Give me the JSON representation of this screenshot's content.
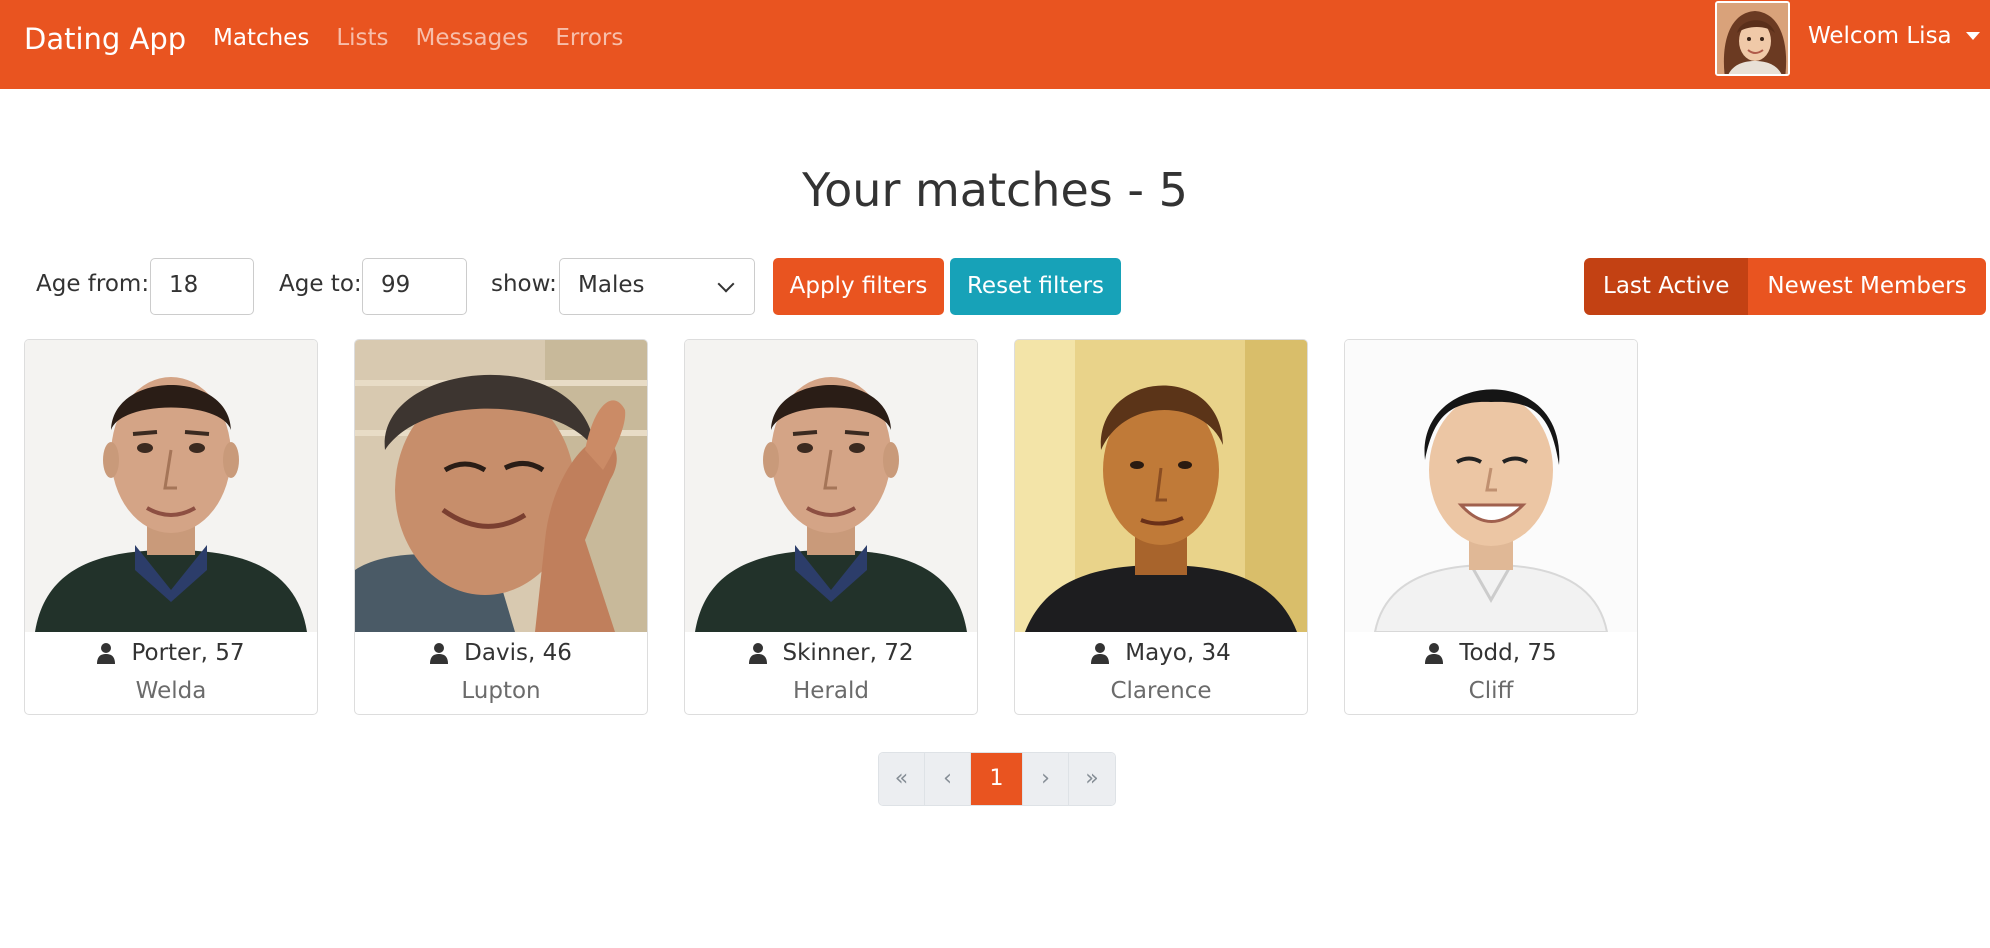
{
  "navbar": {
    "brand": "Dating App",
    "links": [
      "Matches",
      "Lists",
      "Messages",
      "Errors"
    ],
    "active_link": "Matches",
    "welcome": "Welcom Lisa",
    "color": "#e95420"
  },
  "page": {
    "title": "Your matches - 5"
  },
  "filters": {
    "age_from_label": "Age from:",
    "age_from_value": "18",
    "age_to_label": "Age to:",
    "age_to_value": "99",
    "show_label": "show:",
    "show_value": "Males",
    "apply_label": "Apply filters",
    "reset_label": "Reset filters"
  },
  "sort": {
    "last_active": "Last Active",
    "newest_members": "Newest Members",
    "selected": "Last Active"
  },
  "members": [
    {
      "name": "Porter, 57",
      "city": "Welda"
    },
    {
      "name": "Davis, 46",
      "city": "Lupton"
    },
    {
      "name": "Skinner, 72",
      "city": "Herald"
    },
    {
      "name": "Mayo, 34",
      "city": "Clarence"
    },
    {
      "name": "Todd, 75",
      "city": "Cliff"
    }
  ],
  "pagination": {
    "first": "«",
    "prev": "‹",
    "current": "1",
    "next": "›",
    "last": "»"
  },
  "colors": {
    "primary": "#e95420",
    "primary_active": "#c34113",
    "info": "#17a2b8"
  }
}
